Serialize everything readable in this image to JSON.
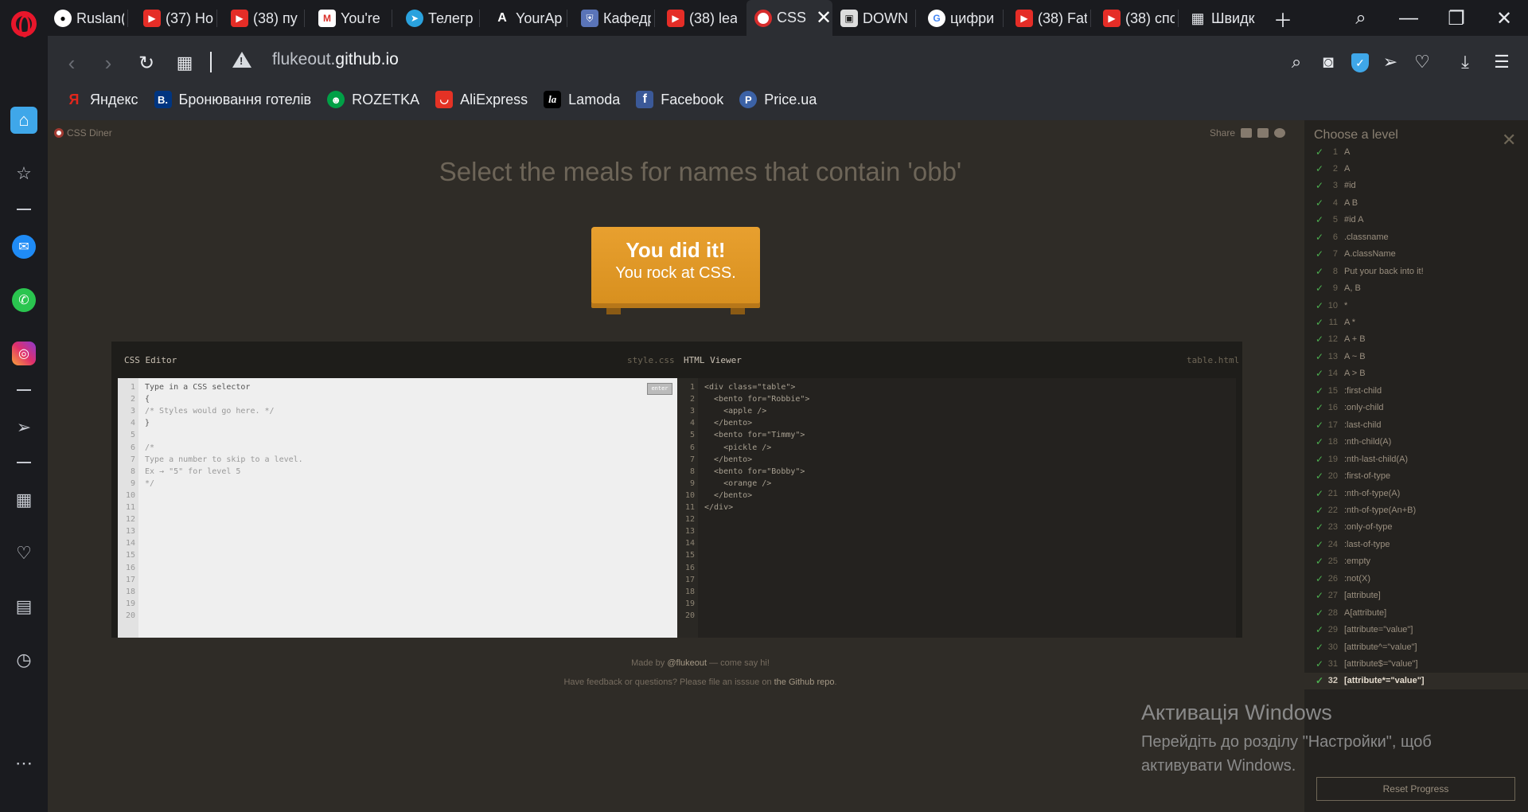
{
  "browser": {
    "tabs": [
      {
        "label": "Ruslan(",
        "icon": "github-icon"
      },
      {
        "label": "(37) Ho",
        "icon": "youtube-icon"
      },
      {
        "label": "(38) пу",
        "icon": "youtube-icon"
      },
      {
        "label": "You're",
        "icon": "gmail-icon"
      },
      {
        "label": "Телегр",
        "icon": "telegram-icon"
      },
      {
        "label": "YourAp",
        "icon": "yourapp-icon"
      },
      {
        "label": "Кафедр",
        "icon": "department-icon"
      },
      {
        "label": "(38) lea",
        "icon": "youtube-icon"
      },
      {
        "label": "CSS",
        "icon": "css-diner-icon",
        "active": true
      },
      {
        "label": "DOWN",
        "icon": "download-site-icon"
      },
      {
        "label": "цифри",
        "icon": "google-icon"
      },
      {
        "label": "(38) Fat",
        "icon": "youtube-icon"
      },
      {
        "label": "(38) спо",
        "icon": "youtube-icon"
      },
      {
        "label": "Швидк",
        "icon": "speed-dial-icon"
      }
    ],
    "url_domain_prefix": "flukeout.",
    "url_domain_main": "github.io",
    "bookmarks": [
      {
        "label": "Яндекс",
        "icon": "yandex-icon",
        "color": "#e1261c",
        "glyph": "Я"
      },
      {
        "label": "Бронювання готелів",
        "icon": "booking-icon",
        "color": "#003580",
        "glyph": "B."
      },
      {
        "label": "ROZETKA",
        "icon": "rozetka-icon",
        "color": "#00a046",
        "glyph": "☻"
      },
      {
        "label": "AliExpress",
        "icon": "aliexpress-icon",
        "color": "#e43225",
        "glyph": "◡"
      },
      {
        "label": "Lamoda",
        "icon": "lamoda-icon",
        "color": "#000000",
        "glyph": "la"
      },
      {
        "label": "Facebook",
        "icon": "facebook-icon",
        "color": "#3b5998",
        "glyph": "f"
      },
      {
        "label": "Price.ua",
        "icon": "priceua-icon",
        "color": "#3c62a6",
        "glyph": "P"
      }
    ]
  },
  "page": {
    "brand": "CSS Diner",
    "share": "Share",
    "instruction": "Select the meals for names that contain 'obb'",
    "success_line1": "You did it!",
    "success_line2": "You rock at CSS.",
    "css_editor_title": "CSS Editor",
    "css_editor_file": "style.css",
    "html_viewer_title": "HTML Viewer",
    "html_viewer_file": "table.html",
    "enter_button": "enter",
    "css_lines": [
      "Type in a CSS selector",
      "{",
      "/* Styles would go here. */",
      "}",
      "",
      "/*",
      "Type a number to skip to a level.",
      "Ex → \"5\" for level 5",
      "*/"
    ],
    "html_lines": [
      "<div class=\"table\">",
      "  <bento for=\"Robbie\">",
      "    <apple />",
      "  </bento>",
      "  <bento for=\"Timmy\">",
      "    <pickle />",
      "  </bento>",
      "  <bento for=\"Bobby\">",
      "    <orange />",
      "  </bento>",
      "</div>"
    ],
    "line_count": 20,
    "footer_made_by_prefix": "Made by ",
    "footer_made_by_link": "@flukeout",
    "footer_made_by_suffix": " — come say hi!",
    "footer_feedback_prefix": "Have feedback or questions? Please file an isssue on ",
    "footer_feedback_link": "the Github repo",
    "footer_feedback_suffix": "."
  },
  "levels": {
    "title": "Choose a level",
    "active_level": 32,
    "items": [
      {
        "n": "1",
        "label": "A"
      },
      {
        "n": "2",
        "label": "A"
      },
      {
        "n": "3",
        "label": "#id"
      },
      {
        "n": "4",
        "label": "A  B"
      },
      {
        "n": "5",
        "label": "#id  A"
      },
      {
        "n": "6",
        "label": ".classname"
      },
      {
        "n": "7",
        "label": "A.className"
      },
      {
        "n": "8",
        "label": "Put your back into it!"
      },
      {
        "n": "9",
        "label": "A, B"
      },
      {
        "n": "10",
        "label": "*"
      },
      {
        "n": "11",
        "label": "A  *"
      },
      {
        "n": "12",
        "label": "A + B"
      },
      {
        "n": "13",
        "label": "A ~ B"
      },
      {
        "n": "14",
        "label": "A > B"
      },
      {
        "n": "15",
        "label": ":first-child"
      },
      {
        "n": "16",
        "label": ":only-child"
      },
      {
        "n": "17",
        "label": ":last-child"
      },
      {
        "n": "18",
        "label": ":nth-child(A)"
      },
      {
        "n": "19",
        "label": ":nth-last-child(A)"
      },
      {
        "n": "20",
        "label": ":first-of-type"
      },
      {
        "n": "21",
        "label": ":nth-of-type(A)"
      },
      {
        "n": "22",
        "label": ":nth-of-type(An+B)"
      },
      {
        "n": "23",
        "label": ":only-of-type"
      },
      {
        "n": "24",
        "label": ":last-of-type"
      },
      {
        "n": "25",
        "label": ":empty"
      },
      {
        "n": "26",
        "label": ":not(X)"
      },
      {
        "n": "27",
        "label": "[attribute]"
      },
      {
        "n": "28",
        "label": "A[attribute]"
      },
      {
        "n": "29",
        "label": "[attribute=\"value\"]"
      },
      {
        "n": "30",
        "label": "[attribute^=\"value\"]"
      },
      {
        "n": "31",
        "label": "[attribute$=\"value\"]"
      },
      {
        "n": "32",
        "label": "[attribute*=\"value\"]"
      }
    ],
    "reset_label": "Reset Progress"
  },
  "os": {
    "activation_title": "Активація Windows",
    "activation_text": "Перейдіть до розділу \"Настройки\", щоб активувати Windows."
  }
}
